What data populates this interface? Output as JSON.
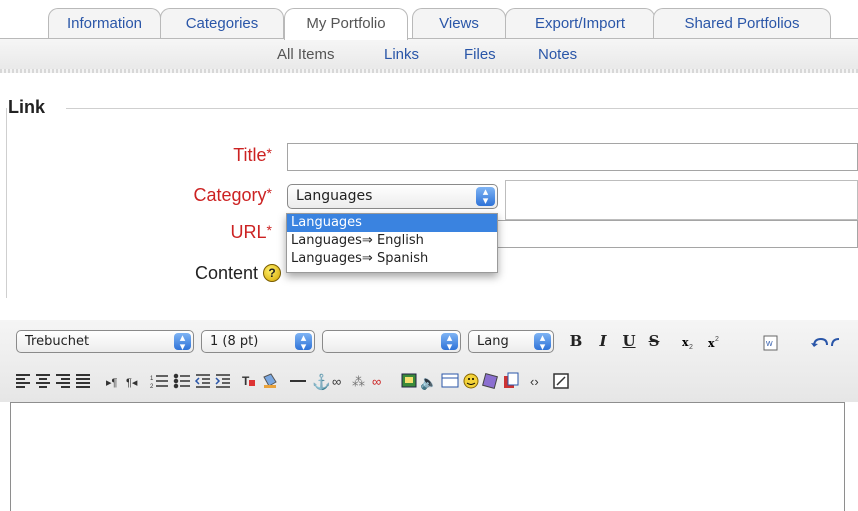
{
  "tabs": [
    {
      "label": "Information"
    },
    {
      "label": "Categories"
    },
    {
      "label": "My Portfolio",
      "active": true
    },
    {
      "label": "Views"
    },
    {
      "label": "Export/Import"
    },
    {
      "label": "Shared Portfolios"
    }
  ],
  "subnav": {
    "all_items": "All Items",
    "links": "Links",
    "files": "Files",
    "notes": "Notes"
  },
  "form": {
    "legend": "Link",
    "title_label": "Title",
    "category_label": "Category",
    "url_label": "URL",
    "content_label": "Content",
    "required_mark": "*",
    "title_value": "",
    "url_value": "",
    "category_selected": "Languages",
    "category_options": [
      "Languages",
      "Languages⇒ English",
      "Languages⇒ Spanish"
    ],
    "help_icon": "?"
  },
  "toolbar": {
    "font_family": "Trebuchet",
    "font_size": "1 (8 pt)",
    "format_value": "",
    "lang": "Lang",
    "bold": "B",
    "italic": "I",
    "underline": "U",
    "strike": "S",
    "icons_row1": [
      "subscript-icon",
      "superscript-icon",
      "paste-word-icon",
      "undo-icon",
      "redo-icon"
    ],
    "icons_row2": [
      "align-left-icon",
      "align-center-icon",
      "align-right-icon",
      "justify-icon",
      "ltr-icon",
      "rtl-icon",
      "ordered-list-icon",
      "unordered-list-icon",
      "outdent-icon",
      "indent-icon",
      "text-color-icon",
      "background-color-icon",
      "horizontal-rule-icon",
      "anchor-icon",
      "link-icon",
      "unlink-icon",
      "no-link-icon",
      "image-icon",
      "media-icon",
      "table-icon",
      "smiley-icon",
      "special-char-icon",
      "spellcheck-icon",
      "html-source-icon",
      "fullscreen-icon"
    ]
  },
  "colors": {
    "link_blue": "#2a56a8",
    "required_red": "#cc2222",
    "select_highlight": "#3a83e0"
  }
}
